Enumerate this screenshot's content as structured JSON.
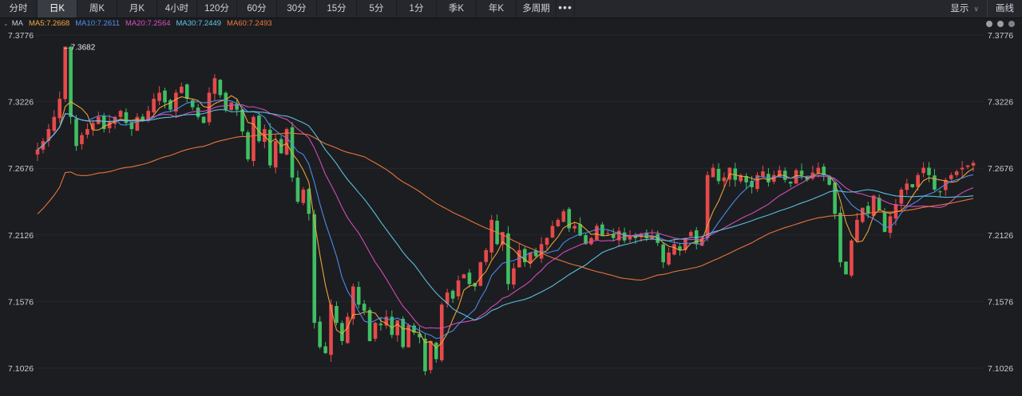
{
  "toolbar": {
    "periods": [
      "分时",
      "日K",
      "周K",
      "月K",
      "4小时",
      "120分",
      "60分",
      "30分",
      "15分",
      "5分",
      "1分",
      "季K",
      "年K",
      "多周期"
    ],
    "active": "日K",
    "more_label": "•••",
    "display_label": "显示",
    "draw_label": "画线"
  },
  "indicator": {
    "label": "MA",
    "items": [
      {
        "text": "MA5:7.2668",
        "color": "#f2a93b"
      },
      {
        "text": "MA10:7.2611",
        "color": "#4f8ff0"
      },
      {
        "text": "MA20:7.2564",
        "color": "#d84fbf"
      },
      {
        "text": "MA30:7.2449",
        "color": "#5ec8e6"
      },
      {
        "text": "MA60:7.2493",
        "color": "#f07a3a"
      }
    ]
  },
  "colors": {
    "up": "#e64a4a",
    "down": "#3fbf62"
  },
  "chart_data": {
    "type": "candlestick",
    "y_ticks": [
      "7.3776",
      "7.3226",
      "7.2676",
      "7.2126",
      "7.1576",
      "7.1026"
    ],
    "ylim": [
      7.1026,
      7.3776
    ],
    "high_marker": "←7.3682",
    "high_value": 7.3682,
    "closes": [
      7.283,
      7.29,
      7.3,
      7.31,
      7.325,
      7.368,
      7.31,
      7.286,
      7.295,
      7.3,
      7.305,
      7.31,
      7.3,
      7.306,
      7.31,
      7.315,
      7.305,
      7.3,
      7.31,
      7.307,
      7.315,
      7.325,
      7.33,
      7.322,
      7.316,
      7.33,
      7.335,
      7.325,
      7.318,
      7.31,
      7.305,
      7.33,
      7.342,
      7.328,
      7.316,
      7.322,
      7.316,
      7.298,
      7.275,
      7.31,
      7.29,
      7.3,
      7.27,
      7.29,
      7.28,
      7.3,
      7.26,
      7.24,
      7.25,
      7.23,
      7.14,
      7.12,
      7.115,
      7.155,
      7.14,
      7.125,
      7.145,
      7.17,
      7.155,
      7.15,
      7.125,
      7.14,
      7.138,
      7.145,
      7.13,
      7.142,
      7.12,
      7.138,
      7.132,
      7.128,
      7.1,
      7.125,
      7.11,
      7.155,
      7.165,
      7.16,
      7.175,
      7.18,
      7.172,
      7.17,
      7.19,
      7.2,
      7.225,
      7.205,
      7.215,
      7.172,
      7.185,
      7.2,
      7.19,
      7.198,
      7.195,
      7.205,
      7.21,
      7.22,
      7.225,
      7.232,
      7.218,
      7.22,
      7.212,
      7.205,
      7.21,
      7.22,
      7.212,
      7.214,
      7.21,
      7.216,
      7.208,
      7.212,
      7.21,
      7.213,
      7.21,
      7.212,
      7.206,
      7.19,
      7.198,
      7.205,
      7.2,
      7.21,
      7.215,
      7.205,
      7.21,
      7.262,
      7.268,
      7.257,
      7.26,
      7.268,
      7.258,
      7.262,
      7.256,
      7.252,
      7.262,
      7.265,
      7.256,
      7.262,
      7.266,
      7.258,
      7.255,
      7.266,
      7.262,
      7.258,
      7.264,
      7.268,
      7.262,
      7.254,
      7.23,
      7.19,
      7.18,
      7.208,
      7.225,
      7.235,
      7.23,
      7.245,
      7.233,
      7.215,
      7.228,
      7.238,
      7.25,
      7.255,
      7.252,
      7.262,
      7.268,
      7.262,
      7.25,
      7.248,
      7.258,
      7.262,
      7.265,
      7.268,
      7.27,
      7.272
    ]
  }
}
